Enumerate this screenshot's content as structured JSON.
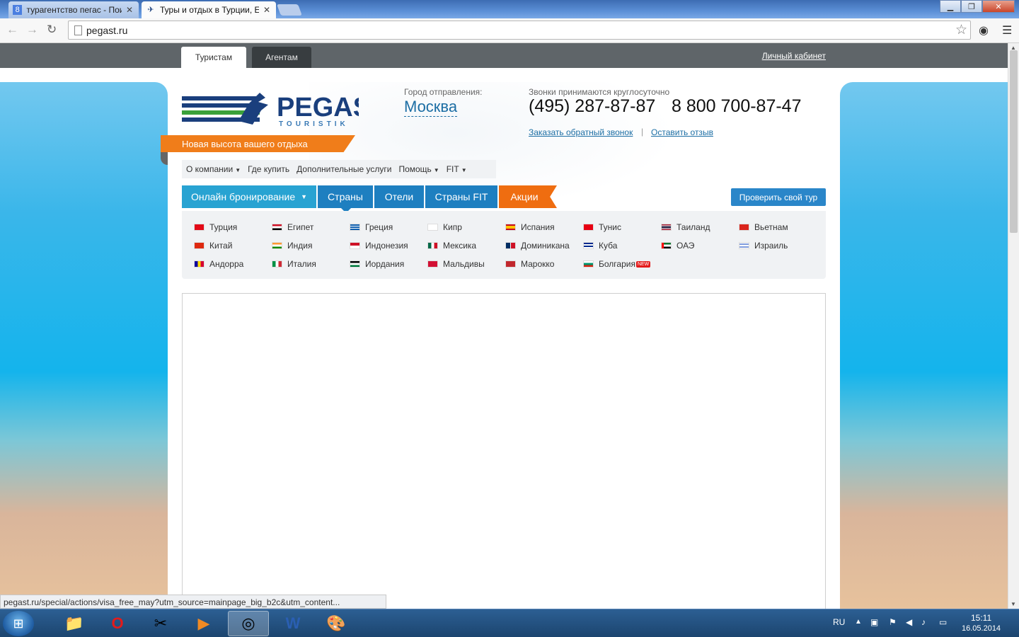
{
  "browser": {
    "tabs": [
      {
        "title": "турагентство пегас - Пои",
        "active": false
      },
      {
        "title": "Туры и отдых в Турции, Е",
        "active": true
      }
    ],
    "url": "pegast.ru",
    "status_url": "pegast.ru/special/actions/visa_free_may?utm_source=mainpage_big_b2c&utm_content..."
  },
  "site": {
    "top_tabs": {
      "tourists": "Туристам",
      "agents": "Агентам"
    },
    "cabinet": "Личный кабинет",
    "logo": {
      "name": "PEGAS",
      "sub": "TOURISTIK"
    },
    "slogan": "Новая высота вашего отдыха",
    "departure_label": "Город отправления:",
    "departure_city": "Москва",
    "calls_label": "Звонки принимаются круглосуточно",
    "phone1": "(495) 287-87-87",
    "phone2": "8 800 700-87-47",
    "callback": "Заказать обратный звонок",
    "separator": "|",
    "feedback": "Оставить отзыв",
    "menu": [
      "О компании",
      "Где купить",
      "Дополнительные услуги",
      "Помощь",
      "FIT"
    ],
    "nav": {
      "online": "Онлайн бронирование",
      "countries": "Страны",
      "hotels": "Отели",
      "fit_countries": "Страны FIT",
      "promo": "Акции"
    },
    "check_tour": "Проверить свой тур",
    "countries": [
      [
        "Турция",
        "Египет",
        "Греция",
        "Кипр",
        "Испания",
        "Тунис",
        "Таиланд",
        "Вьетнам"
      ],
      [
        "Китай",
        "Индия",
        "Индонезия",
        "Мексика",
        "Доминикана",
        "Куба",
        "ОАЭ",
        "Израиль"
      ],
      [
        "Андорра",
        "Италия",
        "Иордания",
        "Мальдивы",
        "Марокко",
        "Болгария"
      ]
    ],
    "new_badge": "NEW"
  },
  "taskbar": {
    "lang": "RU",
    "time": "15:11",
    "date": "16.05.2014"
  },
  "colors": {
    "brand_blue": "#1e7fc0",
    "accent_orange": "#ef6d10"
  }
}
